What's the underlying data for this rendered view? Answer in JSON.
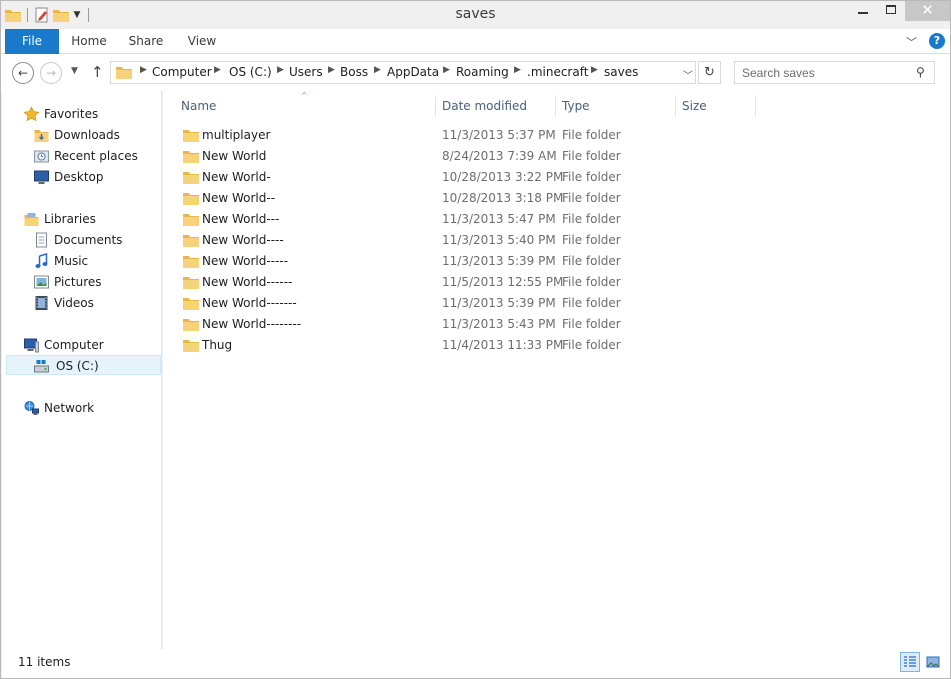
{
  "window": {
    "title": "saves",
    "close_glyph": "✕"
  },
  "ribbon": {
    "tabs": [
      "File",
      "Home",
      "Share",
      "View"
    ],
    "help_glyph": "?"
  },
  "address": {
    "crumbs": [
      "Computer",
      "OS (C:)",
      "Users",
      "Boss",
      "AppData",
      "Roaming",
      ".minecraft",
      "saves"
    ]
  },
  "search": {
    "placeholder": "Search saves"
  },
  "navpane": {
    "favorites": "Favorites",
    "downloads": "Downloads",
    "recent": "Recent places",
    "desktop": "Desktop",
    "libraries": "Libraries",
    "documents": "Documents",
    "music": "Music",
    "pictures": "Pictures",
    "videos": "Videos",
    "computer": "Computer",
    "osc": "OS (C:)",
    "network": "Network"
  },
  "columns": {
    "name": "Name",
    "date": "Date modified",
    "type": "Type",
    "size": "Size"
  },
  "files": [
    {
      "name": "multiplayer",
      "date": "11/3/2013 5:37 PM",
      "type": "File folder"
    },
    {
      "name": "New World",
      "date": "8/24/2013 7:39 AM",
      "type": "File folder"
    },
    {
      "name": "New World-",
      "date": "10/28/2013 3:22 PM",
      "type": "File folder"
    },
    {
      "name": "New World--",
      "date": "10/28/2013 3:18 PM",
      "type": "File folder"
    },
    {
      "name": "New World---",
      "date": "11/3/2013 5:47 PM",
      "type": "File folder"
    },
    {
      "name": "New World----",
      "date": "11/3/2013 5:40 PM",
      "type": "File folder"
    },
    {
      "name": "New World-----",
      "date": "11/3/2013 5:39 PM",
      "type": "File folder"
    },
    {
      "name": "New World------",
      "date": "11/5/2013 12:55 PM",
      "type": "File folder"
    },
    {
      "name": "New World-------",
      "date": "11/3/2013 5:39 PM",
      "type": "File folder"
    },
    {
      "name": "New World--------",
      "date": "11/3/2013 5:43 PM",
      "type": "File folder"
    },
    {
      "name": "Thug",
      "date": "11/4/2013 11:33 PM",
      "type": "File folder"
    }
  ],
  "status": {
    "count": "11 items"
  },
  "colors": {
    "accent": "#1979ca",
    "folder": "#f0c45a",
    "selection": "#e5f3fb"
  }
}
